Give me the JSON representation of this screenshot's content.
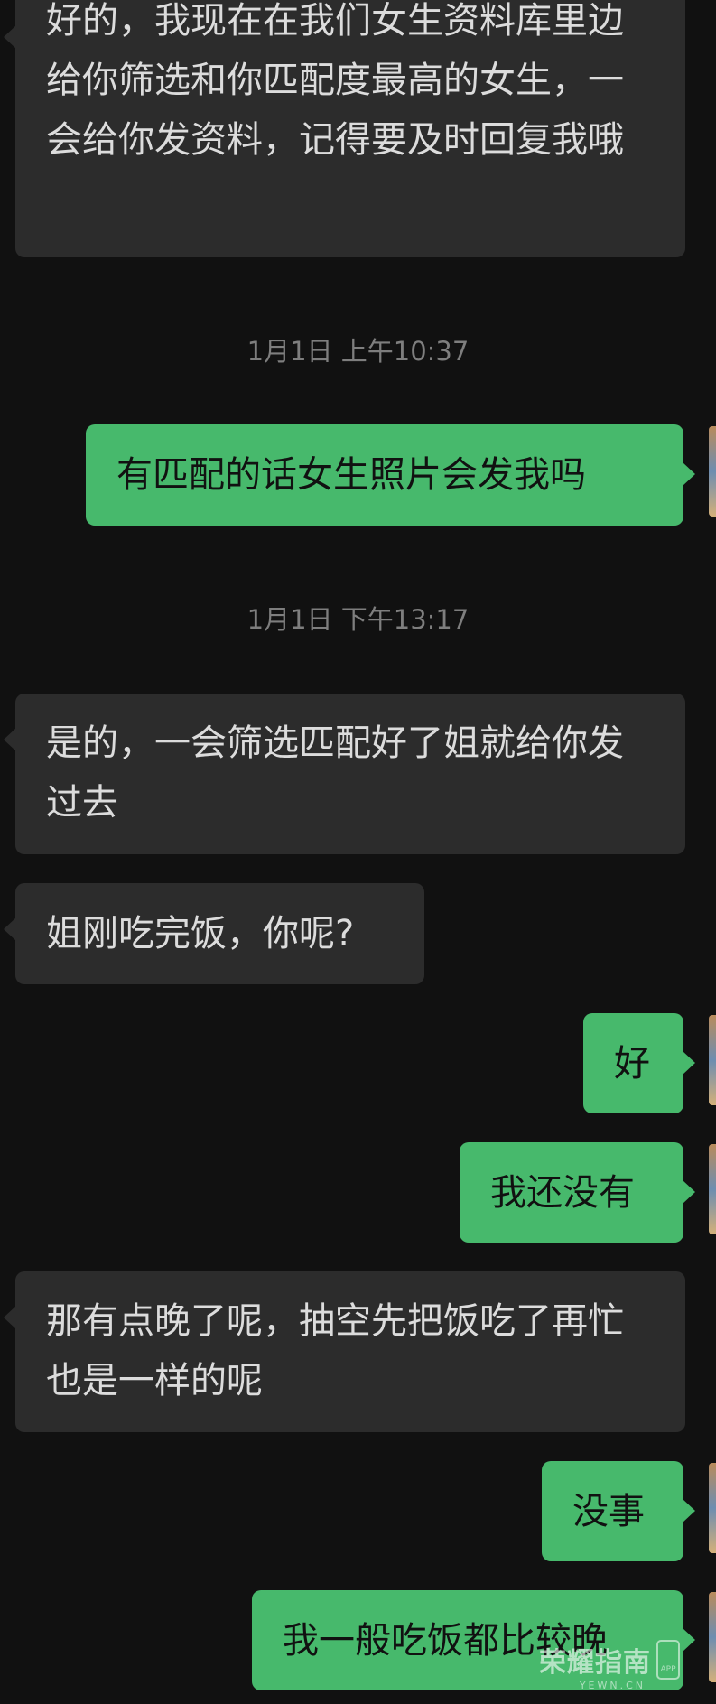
{
  "messages": [
    {
      "id": "m1",
      "side": "in",
      "text": "好的，我现在在我们女生资料库里边给你筛选和你匹配度最高的女生，一会给你发资料，记得要及时回复我哦"
    },
    {
      "id": "m2",
      "side": "out",
      "text": "有匹配的话女生照片会发我吗"
    },
    {
      "id": "m3",
      "side": "in",
      "text": "是的，一会筛选匹配好了姐就给你发过去"
    },
    {
      "id": "m4",
      "side": "in",
      "text": "姐刚吃完饭，你呢?"
    },
    {
      "id": "m5",
      "side": "out",
      "text": "好"
    },
    {
      "id": "m6",
      "side": "out",
      "text": "我还没有"
    },
    {
      "id": "m7",
      "side": "in",
      "text": "那有点晚了呢，抽空先把饭吃了再忙也是一样的呢"
    },
    {
      "id": "m8",
      "side": "out",
      "text": "没事"
    },
    {
      "id": "m9",
      "side": "out",
      "text": "我一般吃饭都比较晚"
    }
  ],
  "timestamps": {
    "t1": "1月1日 上午10:37",
    "t2": "1月1日 下午13:17"
  },
  "watermark": {
    "title": "荣耀指南",
    "badge": "APP",
    "url": "YEWN.CN"
  },
  "colors": {
    "background": "#111111",
    "incoming_bubble": "#2c2c2c",
    "outgoing_bubble": "#47b96c",
    "timestamp_text": "#7e7e7e"
  }
}
